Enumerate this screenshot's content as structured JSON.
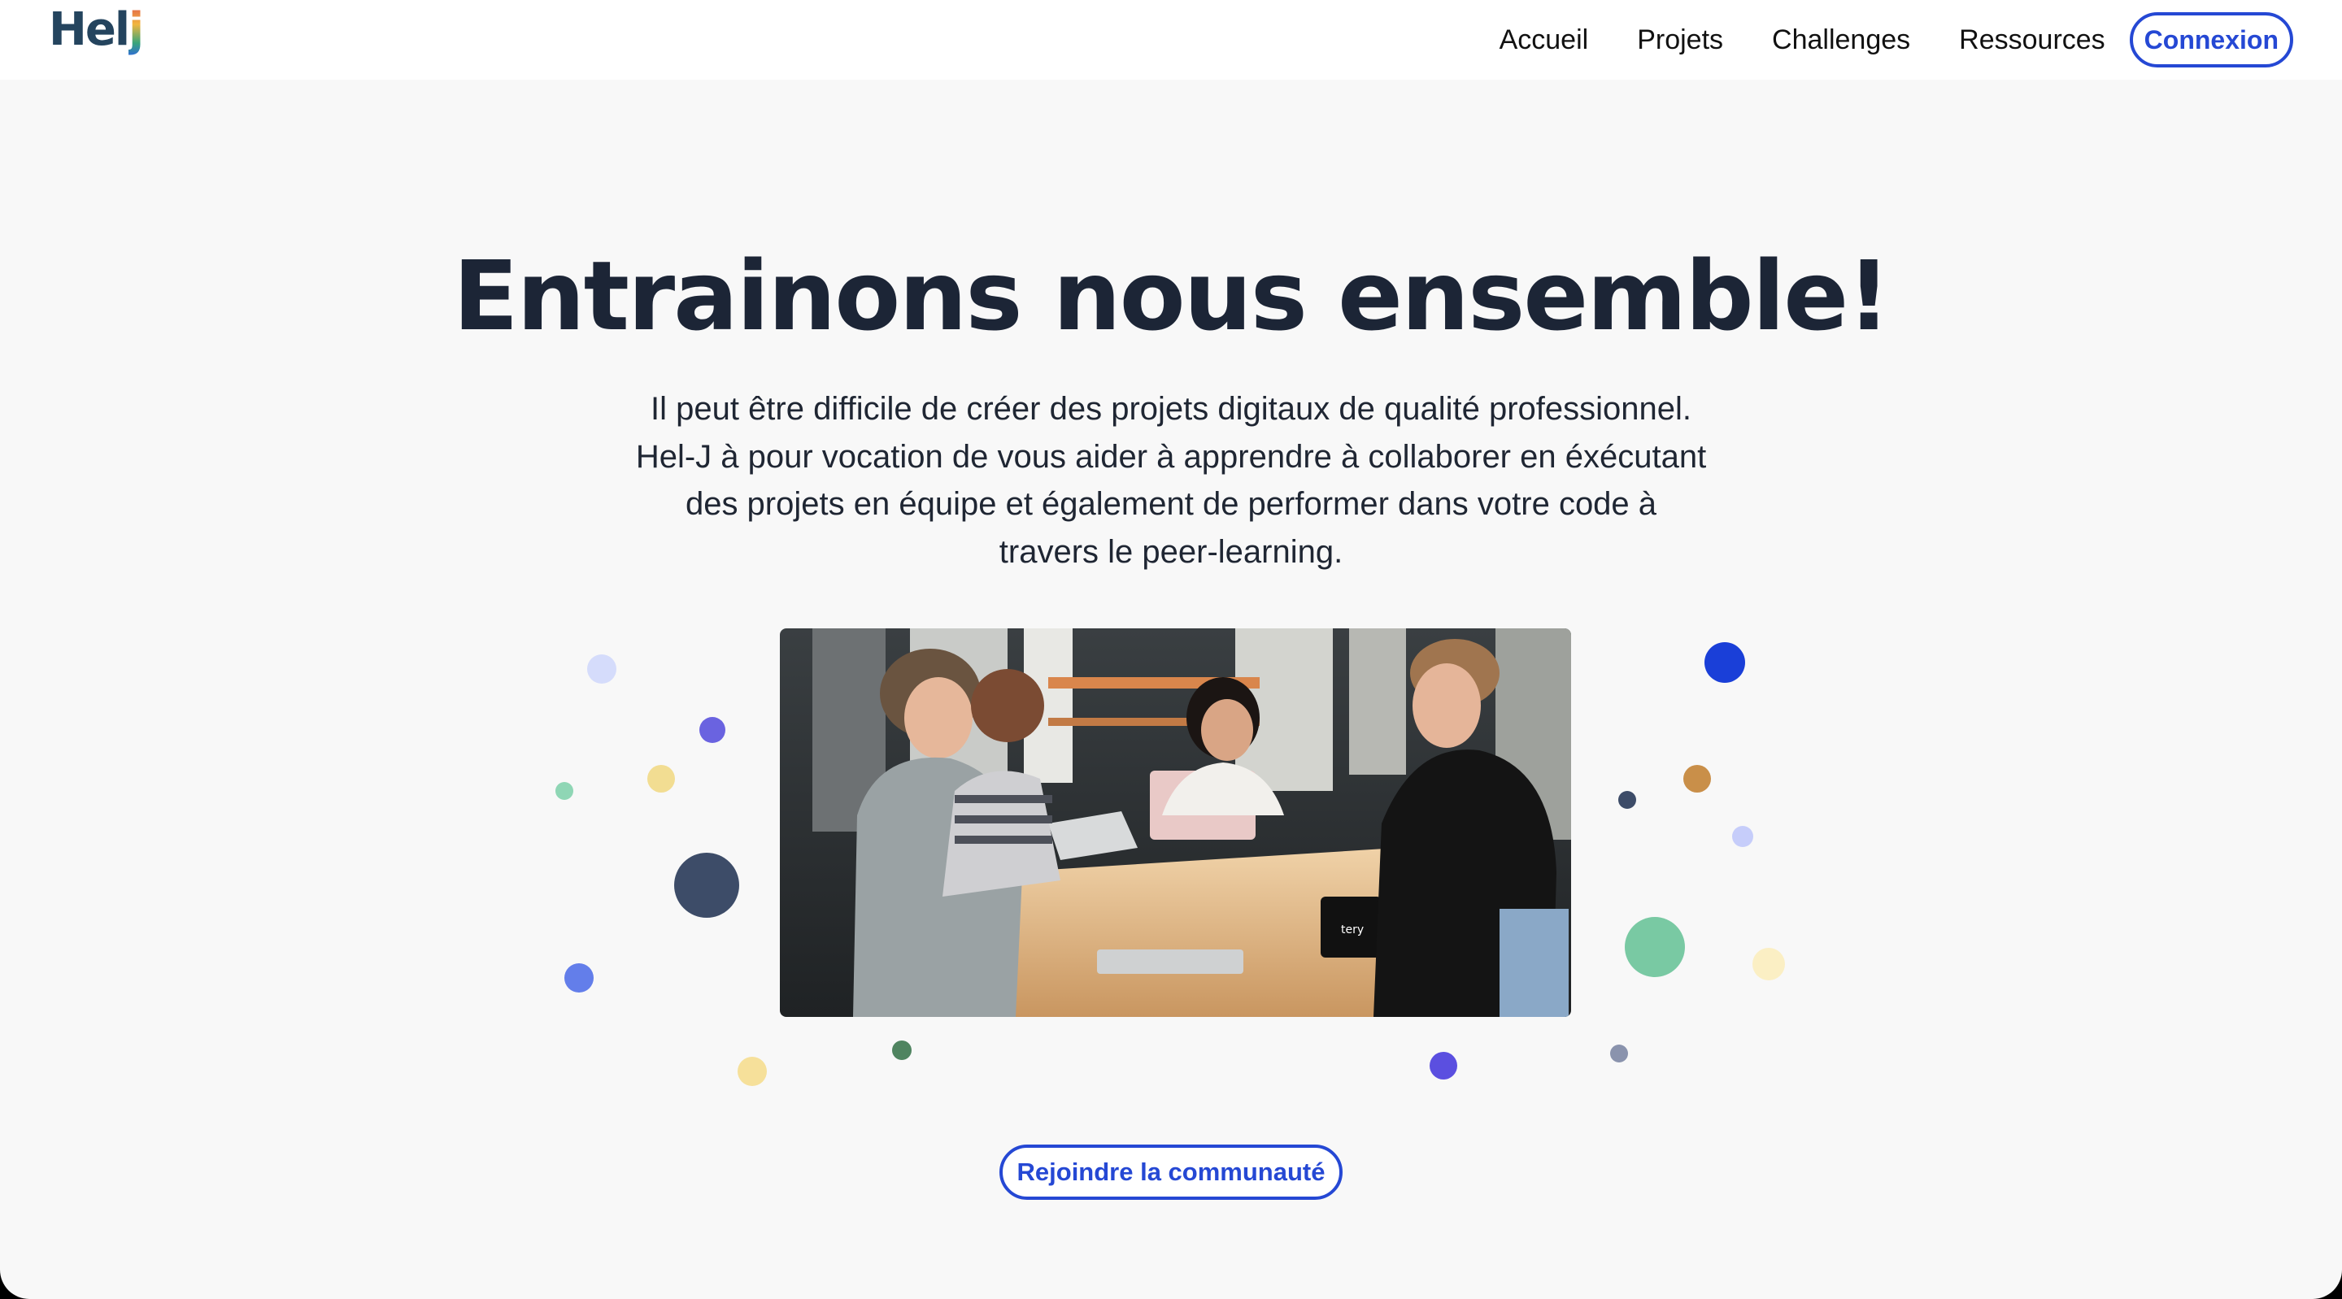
{
  "brand": {
    "logo_text_main": "Hel",
    "logo_text_accent": "j"
  },
  "nav": {
    "links": [
      "Accueil",
      "Projets",
      "Challenges",
      "Ressources"
    ],
    "login_label": "Connexion"
  },
  "hero": {
    "title": "Entrainons nous ensemble!",
    "description_lines": [
      "Il peut être difficile de créer des projets digitaux de qualité professionnel.",
      "Hel-J à pour vocation de vous aider à apprendre à collaborer en éxécutant",
      "des projets en équipe et également de performer dans votre code à",
      "travers le peer-learning."
    ],
    "cta_label": "Rejoindre la communauté",
    "photo_mug_text": "tery"
  },
  "colors": {
    "accent": "#2548d4",
    "heading": "#1c2536",
    "background": "#f8f8f8"
  }
}
